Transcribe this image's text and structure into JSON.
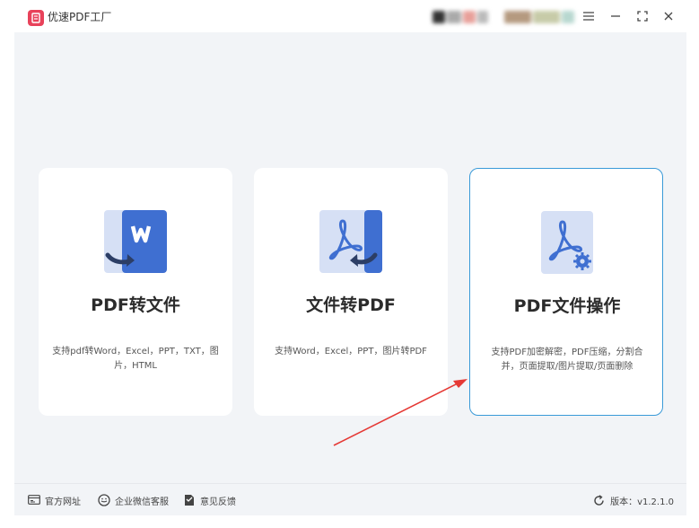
{
  "app": {
    "title": "优速PDF工厂",
    "version_label": "版本：v1.2.1.0"
  },
  "cards": [
    {
      "title": "PDF转文件",
      "description": "支持pdf转Word，Excel，PPT，TXT，图片，HTML",
      "icon": "pdf-to-word-icon"
    },
    {
      "title": "文件转PDF",
      "description": "支持Word，Excel，PPT，图片转PDF",
      "icon": "file-to-pdf-icon"
    },
    {
      "title": "PDF文件操作",
      "description": "支持PDF加密解密，PDF压缩，分割合并，页面提取/图片提取/页面删除",
      "icon": "pdf-settings-icon",
      "selected": true
    }
  ],
  "footer": {
    "links": [
      {
        "label": "官方网址",
        "icon": "website-icon"
      },
      {
        "label": "企业微信客服",
        "icon": "wechat-service-icon"
      },
      {
        "label": "意见反馈",
        "icon": "feedback-icon"
      }
    ]
  },
  "colors": {
    "accent": "#3a9ad8",
    "brand": "#e8425a",
    "word_blue": "#3f6fd1",
    "doc_light": "#d6e0f5",
    "annotation": "#e53935",
    "background": "#f2f4f7"
  }
}
